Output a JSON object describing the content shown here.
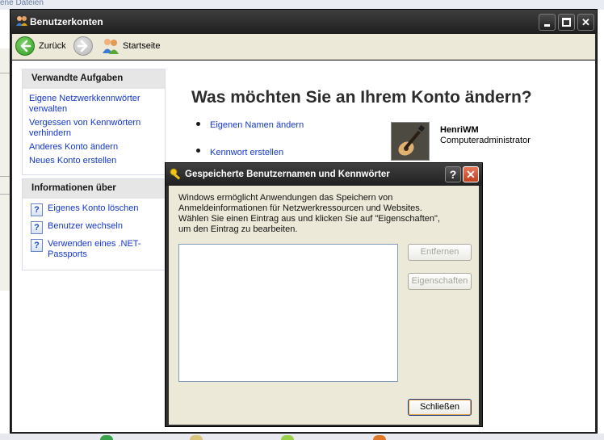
{
  "background": {
    "top_fragment": "ene Dateien"
  },
  "window": {
    "title": "Benutzerkonten",
    "icon": "users-icon",
    "controls": {
      "minimize": "minimize-icon",
      "maximize": "maximize-icon",
      "close": "✕"
    }
  },
  "toolbar": {
    "back_label": "Zurück",
    "forward_icon": "forward-arrow-icon",
    "home_label": "Startseite"
  },
  "sidebar": {
    "related": {
      "title": "Verwandte Aufgaben",
      "links": [
        "Eigene Netzwerkkennwörter verwalten",
        "Vergessen von Kennwörtern verhindern",
        "Anderes Konto ändern",
        "Neues Konto erstellen"
      ]
    },
    "info": {
      "title": "Informationen über",
      "links": [
        "Eigenes Konto löschen",
        "Benutzer wechseln",
        "Verwenden eines .NET-Passports"
      ]
    }
  },
  "main": {
    "heading": "Was möchten Sie an Ihrem Konto ändern?",
    "tasks": [
      "Eigenen Namen ändern",
      "Kennwort erstellen"
    ],
    "account": {
      "name": "HenriWM",
      "type": "Computeradministrator",
      "avatar": "guitar-avatar"
    }
  },
  "dialog": {
    "title": "Gespeicherte Benutzernamen und Kennwörter",
    "help": "?",
    "close": "✕",
    "description": "Windows ermöglicht Anwendungen das Speichern von Anmeldeinformationen für Netzwerkressourcen und Websites. Wählen Sie einen Eintrag aus und klicken Sie auf \"Eigenschaften\", um den Eintrag zu bearbeiten.",
    "buttons": {
      "remove": "Entfernen",
      "properties": "Eigenschaften",
      "close": "Schließen"
    }
  },
  "colors": {
    "link": "#1437c8",
    "title_bar": "#2b2b2b",
    "dialog_face": "#ece9d8"
  }
}
